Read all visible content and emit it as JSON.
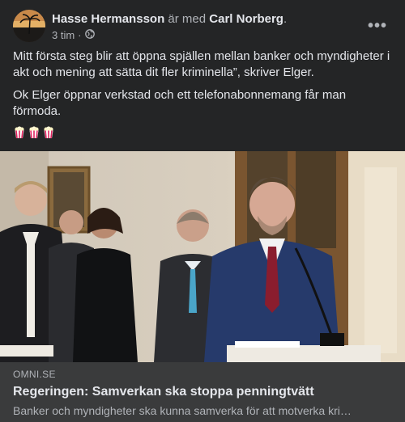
{
  "post": {
    "author": "Hasse Hermansson",
    "with_text": "är med",
    "tagged": "Carl Norberg",
    "period": ".",
    "time": "3 tim",
    "dot": "·",
    "paragraphs": [
      "Mitt första steg blir att öppna spjällen mellan banker och myndigheter i akt och mening att sätta dit fler kriminella”, skriver Elger.",
      "Ok Elger öppnar verkstad och ett telefonabonnemang får man förmoda."
    ],
    "emoji": "popcorn-emoji",
    "emoji_count": 3
  },
  "link": {
    "domain": "OMNI.SE",
    "title": "Regeringen: Samverkan ska stoppa penningtvätt",
    "description": "Banker och myndigheter ska kunna samverka för att motverka kri…"
  },
  "icons": {
    "privacy": "globe-icon",
    "menu": "more-options-icon"
  },
  "colors": {
    "card_bg": "#242526",
    "link_bg": "#3a3b3c",
    "primary_text": "#e4e6eb",
    "secondary_text": "#b0b3b8"
  }
}
